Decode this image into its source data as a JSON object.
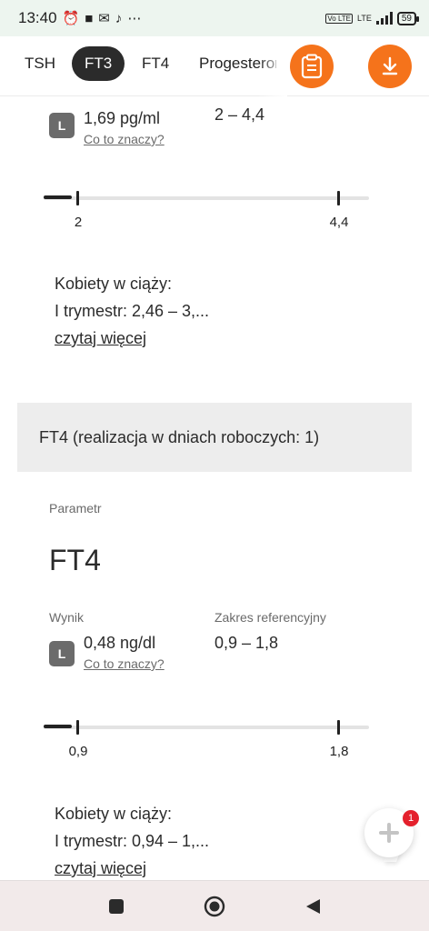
{
  "status_bar": {
    "time": "13:40",
    "icons": [
      "alarm-icon",
      "square-notification-icon",
      "mail-icon",
      "tiktok-icon",
      "more-dots-icon"
    ],
    "network_label": "LTE",
    "volte_label": "Vo LTE",
    "battery": "59"
  },
  "tabs": {
    "items": [
      {
        "label": "TSH"
      },
      {
        "label": "FT3",
        "active": true
      },
      {
        "label": "FT4"
      },
      {
        "label": "Progesteron"
      }
    ],
    "icons": [
      "clipboard-icon",
      "download-icon"
    ],
    "accent_color": "#f5731b"
  },
  "ft3": {
    "badge": "L",
    "result": "1,69 pg/ml",
    "link": "Co to znaczy?",
    "range": "2 – 4,4",
    "scale": {
      "min_label": "2",
      "max_label": "4,4",
      "value_position": "below-range"
    },
    "note_line1": "Kobiety w ciąży:",
    "note_line2": "I trymestr: 2,46 – 3,...",
    "more_link": "czytaj więcej"
  },
  "ft4_header": "FT4 (realizacja w dniach roboczych: 1)",
  "ft4": {
    "param_label": "Parametr",
    "param_name": "FT4",
    "result_label": "Wynik",
    "range_label": "Zakres referencyjny",
    "badge": "L",
    "result": "0,48 ng/dl",
    "link": "Co to znaczy?",
    "range": "0,9 – 1,8",
    "scale": {
      "min_label": "0,9",
      "max_label": "1,8",
      "value_position": "below-range"
    },
    "note_line1": "Kobiety w ciąży:",
    "note_line2": "I trymestr: 0,94 – 1,...",
    "more_link": "czytaj więcej"
  },
  "chat": {
    "badge_count": "1",
    "icon": "chat-plus-icon"
  },
  "nav": {
    "icons": [
      "recent-apps-icon",
      "home-icon",
      "back-icon"
    ]
  }
}
